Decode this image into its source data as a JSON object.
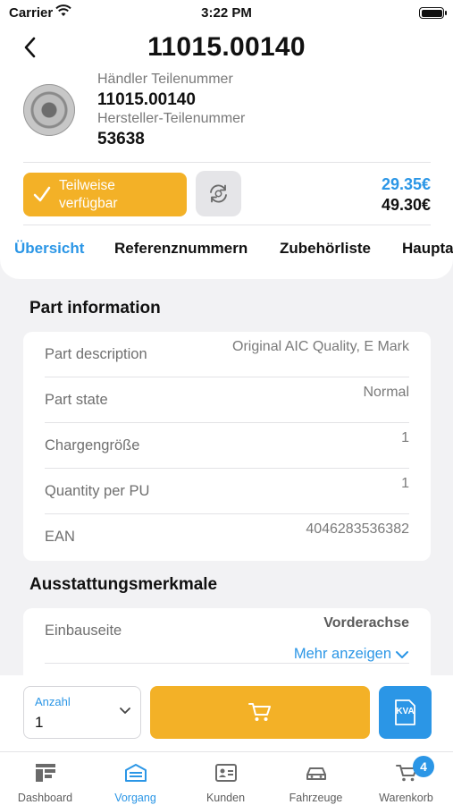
{
  "status_bar": {
    "carrier": "Carrier",
    "time": "3:22 PM"
  },
  "header": {
    "title": "11015.00140",
    "dealer_part_label": "Händler Teilenummer",
    "dealer_part_value": "11015.00140",
    "manufacturer_part_label": "Hersteller-Teilenummer",
    "manufacturer_part_value": "53638",
    "availability_line1": "Teilweise",
    "availability_line2": "verfügbar",
    "price_primary": "29.35€",
    "price_secondary": "49.30€"
  },
  "tabs": [
    {
      "label": "Übersicht",
      "active": true
    },
    {
      "label": "Referenznummern",
      "active": false
    },
    {
      "label": "Zubehörliste",
      "active": false
    },
    {
      "label": "Hauptа",
      "active": false
    }
  ],
  "part_information": {
    "title": "Part information",
    "rows": [
      {
        "label": "Part description",
        "value": "Original AIC Quality, E Mark"
      },
      {
        "label": "Part state",
        "value": "Normal"
      },
      {
        "label": "Chargengröße",
        "value": "1"
      },
      {
        "label": "Quantity per PU",
        "value": "1"
      },
      {
        "label": "EAN",
        "value": "4046283536382"
      }
    ]
  },
  "features": {
    "title": "Ausstattungsmerkmale",
    "rows": [
      {
        "label": "Einbauseite",
        "value": "Vorderachse"
      }
    ],
    "more_label": "Mehr anzeigen"
  },
  "action_bar": {
    "qty_label": "Anzahl",
    "qty_value": "1",
    "kva_label": "KVA"
  },
  "tab_bar": [
    {
      "label": "Dashboard",
      "icon": "dashboard-icon",
      "active": false
    },
    {
      "label": "Vorgang",
      "icon": "garage-icon",
      "active": true
    },
    {
      "label": "Kunden",
      "icon": "id-card-icon",
      "active": false
    },
    {
      "label": "Fahrzeuge",
      "icon": "car-icon",
      "active": false
    },
    {
      "label": "Warenkorb",
      "icon": "cart-icon",
      "active": false,
      "badge": "4"
    }
  ],
  "colors": {
    "accent": "#2b96e6",
    "warning": "#f3b127",
    "background": "#f2f2f4"
  }
}
